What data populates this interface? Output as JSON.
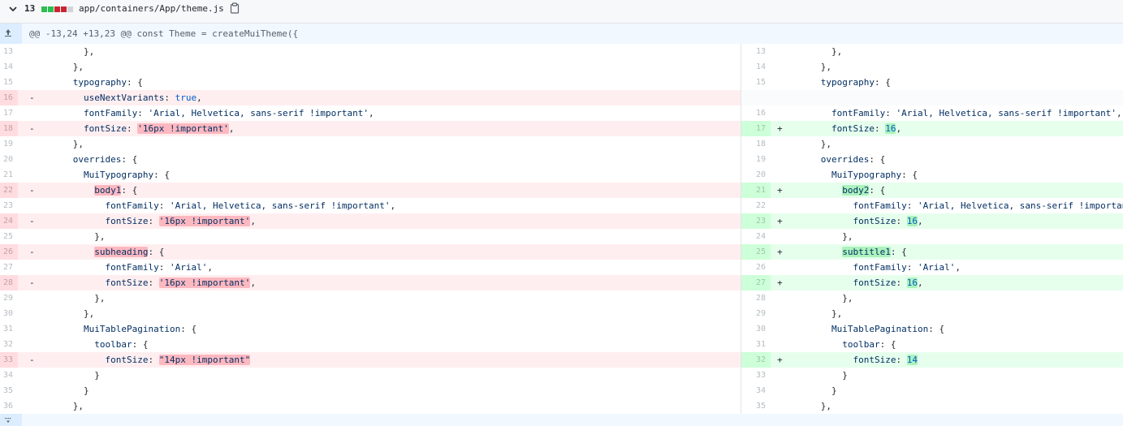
{
  "file": {
    "changes": "13",
    "path": "app/containers/App/theme.js",
    "stat_colors": [
      "#2cbe4e",
      "#2cbe4e",
      "#cb2431",
      "#cb2431",
      "#d1d5da"
    ]
  },
  "hunk": {
    "header": "@@ -13,24 +13,23 @@ const Theme = createMuiTheme({"
  },
  "left": [
    {
      "n": "13",
      "t": "ctx",
      "ind": "        ",
      "parts": [
        {
          "c": "p",
          "x": "},"
        }
      ]
    },
    {
      "n": "14",
      "t": "ctx",
      "ind": "      ",
      "parts": [
        {
          "c": "p",
          "x": "},"
        }
      ]
    },
    {
      "n": "15",
      "t": "ctx",
      "ind": "      ",
      "parts": [
        {
          "c": "k",
          "x": "typography"
        },
        {
          "c": "p",
          "x": ": {"
        }
      ]
    },
    {
      "n": "16",
      "t": "del",
      "ind": "        ",
      "parts": [
        {
          "c": "k",
          "x": "useNextVariants"
        },
        {
          "c": "p",
          "x": ": "
        },
        {
          "c": "kw",
          "x": "true"
        },
        {
          "c": "p",
          "x": ","
        }
      ]
    },
    {
      "n": "17",
      "t": "ctx",
      "ind": "        ",
      "parts": [
        {
          "c": "k",
          "x": "fontFamily"
        },
        {
          "c": "p",
          "x": ": "
        },
        {
          "c": "s",
          "x": "'Arial, Helvetica, sans-serif !important'"
        },
        {
          "c": "p",
          "x": ","
        }
      ]
    },
    {
      "n": "18",
      "t": "del",
      "ind": "        ",
      "parts": [
        {
          "c": "k",
          "x": "fontSize"
        },
        {
          "c": "p",
          "x": ": "
        },
        {
          "c": "s hl-del",
          "x": "'16px !important'"
        },
        {
          "c": "p",
          "x": ","
        }
      ]
    },
    {
      "n": "19",
      "t": "ctx",
      "ind": "      ",
      "parts": [
        {
          "c": "p",
          "x": "},"
        }
      ]
    },
    {
      "n": "20",
      "t": "ctx",
      "ind": "      ",
      "parts": [
        {
          "c": "k",
          "x": "overrides"
        },
        {
          "c": "p",
          "x": ": {"
        }
      ]
    },
    {
      "n": "21",
      "t": "ctx",
      "ind": "        ",
      "parts": [
        {
          "c": "k",
          "x": "MuiTypography"
        },
        {
          "c": "p",
          "x": ": {"
        }
      ]
    },
    {
      "n": "22",
      "t": "del",
      "ind": "          ",
      "parts": [
        {
          "c": "k hl-del",
          "x": "body1"
        },
        {
          "c": "p",
          "x": ": {"
        }
      ]
    },
    {
      "n": "23",
      "t": "ctx",
      "ind": "            ",
      "parts": [
        {
          "c": "k",
          "x": "fontFamily"
        },
        {
          "c": "p",
          "x": ": "
        },
        {
          "c": "s",
          "x": "'Arial, Helvetica, sans-serif !important'"
        },
        {
          "c": "p",
          "x": ","
        }
      ]
    },
    {
      "n": "24",
      "t": "del",
      "ind": "            ",
      "parts": [
        {
          "c": "k",
          "x": "fontSize"
        },
        {
          "c": "p",
          "x": ": "
        },
        {
          "c": "s hl-del",
          "x": "'16px !important'"
        },
        {
          "c": "p",
          "x": ","
        }
      ]
    },
    {
      "n": "25",
      "t": "ctx",
      "ind": "          ",
      "parts": [
        {
          "c": "p",
          "x": "},"
        }
      ]
    },
    {
      "n": "26",
      "t": "del",
      "ind": "          ",
      "parts": [
        {
          "c": "k hl-del",
          "x": "subheading"
        },
        {
          "c": "p",
          "x": ": {"
        }
      ]
    },
    {
      "n": "27",
      "t": "ctx",
      "ind": "            ",
      "parts": [
        {
          "c": "k",
          "x": "fontFamily"
        },
        {
          "c": "p",
          "x": ": "
        },
        {
          "c": "s",
          "x": "'Arial'"
        },
        {
          "c": "p",
          "x": ","
        }
      ]
    },
    {
      "n": "28",
      "t": "del",
      "ind": "            ",
      "parts": [
        {
          "c": "k",
          "x": "fontSize"
        },
        {
          "c": "p",
          "x": ": "
        },
        {
          "c": "s hl-del",
          "x": "'16px !important'"
        },
        {
          "c": "p",
          "x": ","
        }
      ]
    },
    {
      "n": "29",
      "t": "ctx",
      "ind": "          ",
      "parts": [
        {
          "c": "p",
          "x": "},"
        }
      ]
    },
    {
      "n": "30",
      "t": "ctx",
      "ind": "        ",
      "parts": [
        {
          "c": "p",
          "x": "},"
        }
      ]
    },
    {
      "n": "31",
      "t": "ctx",
      "ind": "        ",
      "parts": [
        {
          "c": "k",
          "x": "MuiTablePagination"
        },
        {
          "c": "p",
          "x": ": {"
        }
      ]
    },
    {
      "n": "32",
      "t": "ctx",
      "ind": "          ",
      "parts": [
        {
          "c": "k",
          "x": "toolbar"
        },
        {
          "c": "p",
          "x": ": {"
        }
      ]
    },
    {
      "n": "33",
      "t": "del",
      "ind": "            ",
      "parts": [
        {
          "c": "k",
          "x": "fontSize"
        },
        {
          "c": "p",
          "x": ": "
        },
        {
          "c": "s hl-del",
          "x": "\"14px !important\""
        }
      ]
    },
    {
      "n": "34",
      "t": "ctx",
      "ind": "          ",
      "parts": [
        {
          "c": "p",
          "x": "}"
        }
      ]
    },
    {
      "n": "35",
      "t": "ctx",
      "ind": "        ",
      "parts": [
        {
          "c": "p",
          "x": "}"
        }
      ]
    },
    {
      "n": "36",
      "t": "ctx",
      "ind": "      ",
      "parts": [
        {
          "c": "p",
          "x": "},"
        }
      ]
    }
  ],
  "right": [
    {
      "n": "13",
      "t": "ctx",
      "ind": "        ",
      "parts": [
        {
          "c": "p",
          "x": "},"
        }
      ]
    },
    {
      "n": "14",
      "t": "ctx",
      "ind": "      ",
      "parts": [
        {
          "c": "p",
          "x": "},"
        }
      ]
    },
    {
      "n": "15",
      "t": "ctx",
      "ind": "      ",
      "parts": [
        {
          "c": "k",
          "x": "typography"
        },
        {
          "c": "p",
          "x": ": {"
        }
      ]
    },
    {
      "n": "",
      "t": "empty",
      "ind": "",
      "parts": []
    },
    {
      "n": "16",
      "t": "ctx",
      "ind": "        ",
      "parts": [
        {
          "c": "k",
          "x": "fontFamily"
        },
        {
          "c": "p",
          "x": ": "
        },
        {
          "c": "s",
          "x": "'Arial, Helvetica, sans-serif !important'"
        },
        {
          "c": "p",
          "x": ","
        }
      ]
    },
    {
      "n": "17",
      "t": "add",
      "ind": "        ",
      "parts": [
        {
          "c": "k",
          "x": "fontSize"
        },
        {
          "c": "p",
          "x": ": "
        },
        {
          "c": "kw hl-add",
          "x": "16"
        },
        {
          "c": "p",
          "x": ","
        }
      ]
    },
    {
      "n": "18",
      "t": "ctx",
      "ind": "      ",
      "parts": [
        {
          "c": "p",
          "x": "},"
        }
      ]
    },
    {
      "n": "19",
      "t": "ctx",
      "ind": "      ",
      "parts": [
        {
          "c": "k",
          "x": "overrides"
        },
        {
          "c": "p",
          "x": ": {"
        }
      ]
    },
    {
      "n": "20",
      "t": "ctx",
      "ind": "        ",
      "parts": [
        {
          "c": "k",
          "x": "MuiTypography"
        },
        {
          "c": "p",
          "x": ": {"
        }
      ]
    },
    {
      "n": "21",
      "t": "add",
      "ind": "          ",
      "parts": [
        {
          "c": "k hl-add",
          "x": "body2"
        },
        {
          "c": "p",
          "x": ": {"
        }
      ]
    },
    {
      "n": "22",
      "t": "ctx",
      "ind": "            ",
      "parts": [
        {
          "c": "k",
          "x": "fontFamily"
        },
        {
          "c": "p",
          "x": ": "
        },
        {
          "c": "s",
          "x": "'Arial, Helvetica, sans-serif !important'"
        },
        {
          "c": "p",
          "x": ","
        }
      ]
    },
    {
      "n": "23",
      "t": "add",
      "ind": "            ",
      "parts": [
        {
          "c": "k",
          "x": "fontSize"
        },
        {
          "c": "p",
          "x": ": "
        },
        {
          "c": "kw hl-add",
          "x": "16"
        },
        {
          "c": "p",
          "x": ","
        }
      ]
    },
    {
      "n": "24",
      "t": "ctx",
      "ind": "          ",
      "parts": [
        {
          "c": "p",
          "x": "},"
        }
      ]
    },
    {
      "n": "25",
      "t": "add",
      "ind": "          ",
      "parts": [
        {
          "c": "k hl-add",
          "x": "subtitle1"
        },
        {
          "c": "p",
          "x": ": {"
        }
      ]
    },
    {
      "n": "26",
      "t": "ctx",
      "ind": "            ",
      "parts": [
        {
          "c": "k",
          "x": "fontFamily"
        },
        {
          "c": "p",
          "x": ": "
        },
        {
          "c": "s",
          "x": "'Arial'"
        },
        {
          "c": "p",
          "x": ","
        }
      ]
    },
    {
      "n": "27",
      "t": "add",
      "ind": "            ",
      "parts": [
        {
          "c": "k",
          "x": "fontSize"
        },
        {
          "c": "p",
          "x": ": "
        },
        {
          "c": "kw hl-add",
          "x": "16"
        },
        {
          "c": "p",
          "x": ","
        }
      ]
    },
    {
      "n": "28",
      "t": "ctx",
      "ind": "          ",
      "parts": [
        {
          "c": "p",
          "x": "},"
        }
      ]
    },
    {
      "n": "29",
      "t": "ctx",
      "ind": "        ",
      "parts": [
        {
          "c": "p",
          "x": "},"
        }
      ]
    },
    {
      "n": "30",
      "t": "ctx",
      "ind": "        ",
      "parts": [
        {
          "c": "k",
          "x": "MuiTablePagination"
        },
        {
          "c": "p",
          "x": ": {"
        }
      ]
    },
    {
      "n": "31",
      "t": "ctx",
      "ind": "          ",
      "parts": [
        {
          "c": "k",
          "x": "toolbar"
        },
        {
          "c": "p",
          "x": ": {"
        }
      ]
    },
    {
      "n": "32",
      "t": "add",
      "ind": "            ",
      "parts": [
        {
          "c": "k",
          "x": "fontSize"
        },
        {
          "c": "p",
          "x": ": "
        },
        {
          "c": "kw hl-add",
          "x": "14"
        }
      ]
    },
    {
      "n": "33",
      "t": "ctx",
      "ind": "          ",
      "parts": [
        {
          "c": "p",
          "x": "}"
        }
      ]
    },
    {
      "n": "34",
      "t": "ctx",
      "ind": "        ",
      "parts": [
        {
          "c": "p",
          "x": "}"
        }
      ]
    },
    {
      "n": "35",
      "t": "ctx",
      "ind": "      ",
      "parts": [
        {
          "c": "p",
          "x": "},"
        }
      ]
    }
  ],
  "icons": {
    "collapse": "chevron-down-icon",
    "copy": "clipboard-icon",
    "expand_up": "expand-up-icon",
    "expand_down": "expand-down-icon"
  }
}
